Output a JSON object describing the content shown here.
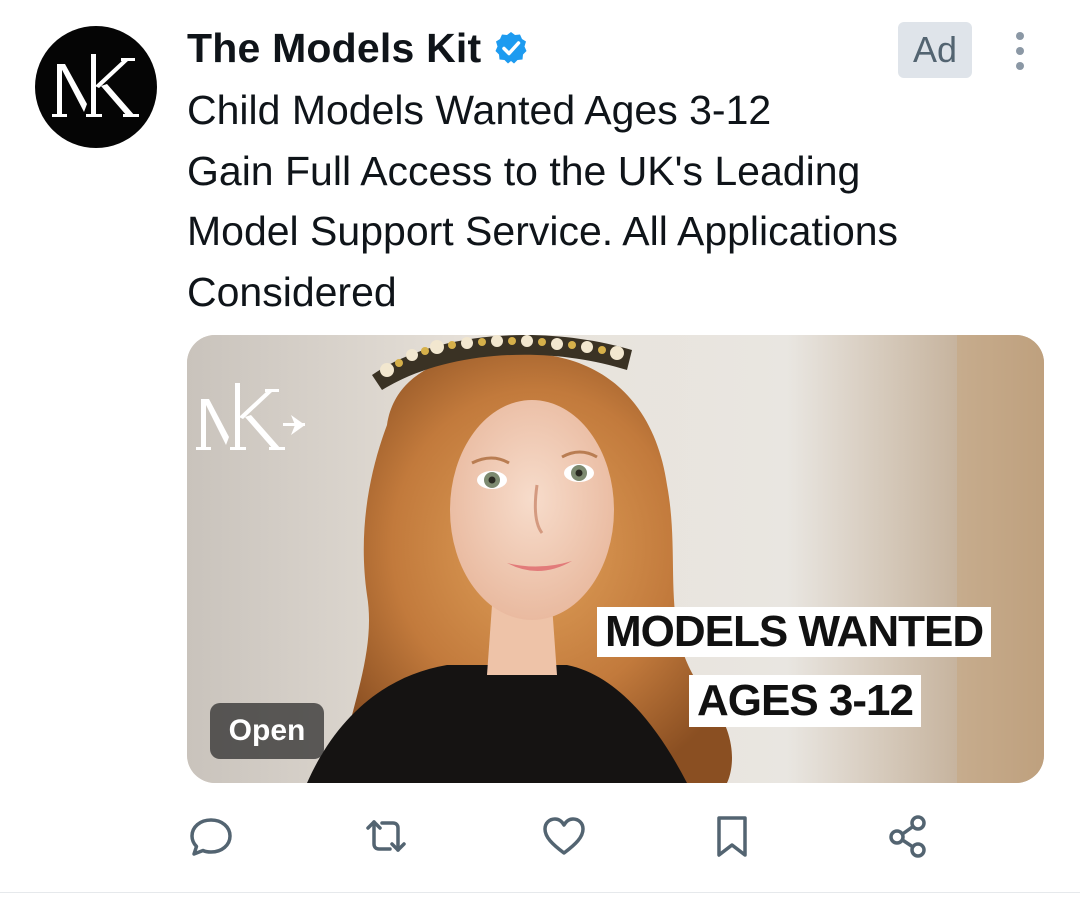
{
  "post": {
    "author_name": "The Models Kit",
    "avatar_logo_text": "MK",
    "ad_label": "Ad",
    "body_lines": [
      "Child Models Wanted Ages 3-12",
      "Gain Full Access to the UK's Leading",
      "Model Support Service. All Applications",
      "Considered"
    ],
    "media": {
      "logo_text": "MK",
      "caption_line1": "MODELS WANTED",
      "caption_line2": "AGES 3-12",
      "open_label": "Open"
    }
  },
  "icons": {
    "verified": "verified-badge-icon",
    "more": "more-vertical-icon",
    "reply": "reply-icon",
    "repost": "repost-icon",
    "like": "heart-icon",
    "bookmark": "bookmark-icon",
    "share": "share-icon"
  },
  "colors": {
    "text": "#0f1419",
    "secondary": "#536471",
    "verified_blue": "#1d9bf0",
    "ad_badge_bg": "#dfe4ea"
  }
}
